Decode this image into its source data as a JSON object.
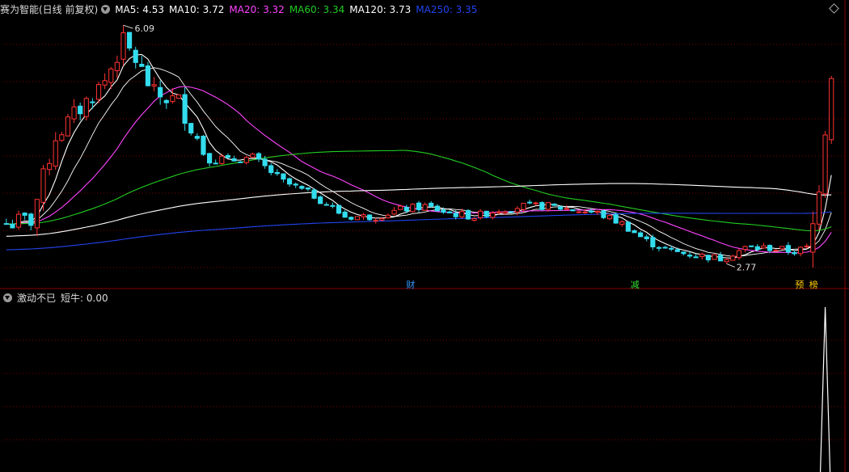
{
  "main_header": {
    "stock_label": "赛为智能(日线 前复权)",
    "indicators": [
      {
        "label": "MA5: 4.53",
        "color": "#ffffff"
      },
      {
        "label": "MA10: 3.72",
        "color": "#ffffff"
      },
      {
        "label": "MA20: 3.32",
        "color": "#ff44ff"
      },
      {
        "label": "MA60: 3.34",
        "color": "#22cc22"
      },
      {
        "label": "MA120: 3.73",
        "color": "#ffffff"
      },
      {
        "label": "MA250: 3.35",
        "color": "#2244ee"
      }
    ]
  },
  "sub_header": {
    "title": "激动不已",
    "value_label": "短牛: 0.00"
  },
  "colors": {
    "up": "#ff3333",
    "down": "#33ddee",
    "ma5": "#ffffff",
    "ma10": "#ffffff",
    "ma20": "#ff44ff",
    "ma60": "#22cc22",
    "ma120": "#ffffff",
    "ma250": "#2244ee",
    "grid": "#7a0000"
  },
  "chart_data": {
    "type": "candlestick",
    "ylim": [
      2.5,
      6.3
    ],
    "high_label": "6.09",
    "low_label": "2.77",
    "events": [
      {
        "label": "财",
        "position": 0.49,
        "color": "#3399ff"
      },
      {
        "label": "减",
        "position": 0.76,
        "color": "#33dd33"
      },
      {
        "label": "预",
        "position": 0.958,
        "color": "#ffcc00"
      },
      {
        "label": "榜",
        "position": 0.975,
        "color": "#ffcc00"
      }
    ],
    "price_keyframes": [
      [
        0,
        3.35
      ],
      [
        4,
        3.4
      ],
      [
        8,
        4.6
      ],
      [
        12,
        5.0
      ],
      [
        16,
        5.4
      ],
      [
        19,
        5.95
      ],
      [
        21,
        5.7
      ],
      [
        24,
        5.2
      ],
      [
        28,
        5.1
      ],
      [
        32,
        4.4
      ],
      [
        36,
        4.25
      ],
      [
        40,
        4.3
      ],
      [
        45,
        3.95
      ],
      [
        50,
        3.75
      ],
      [
        55,
        3.45
      ],
      [
        60,
        3.45
      ],
      [
        64,
        3.55
      ],
      [
        68,
        3.6
      ],
      [
        72,
        3.5
      ],
      [
        76,
        3.45
      ],
      [
        80,
        3.55
      ],
      [
        84,
        3.6
      ],
      [
        88,
        3.6
      ],
      [
        92,
        3.55
      ],
      [
        96,
        3.5
      ],
      [
        100,
        3.35
      ],
      [
        104,
        3.1
      ],
      [
        108,
        2.95
      ],
      [
        112,
        2.9
      ],
      [
        116,
        2.85
      ],
      [
        120,
        3.0
      ],
      [
        124,
        3.0
      ],
      [
        128,
        2.95
      ],
      [
        130,
        3.0
      ],
      [
        131,
        3.3
      ],
      [
        132,
        4.0
      ],
      [
        133,
        4.8
      ],
      [
        134,
        5.6
      ]
    ],
    "candle_count": 135,
    "ma_series": [
      {
        "name": "MA5",
        "key": "ma5",
        "period": 5
      },
      {
        "name": "MA10",
        "key": "ma10",
        "period": 10
      },
      {
        "name": "MA20",
        "key": "ma20",
        "period": 20
      },
      {
        "name": "MA60",
        "key": "ma60",
        "period": 60
      },
      {
        "name": "MA120",
        "key": "ma120",
        "period": 120
      },
      {
        "name": "MA250",
        "key": "ma250",
        "period": 250
      }
    ],
    "sub_indicator": {
      "name": "短牛",
      "spike_index": 133,
      "spike_value": 1,
      "baseline": 0
    }
  }
}
